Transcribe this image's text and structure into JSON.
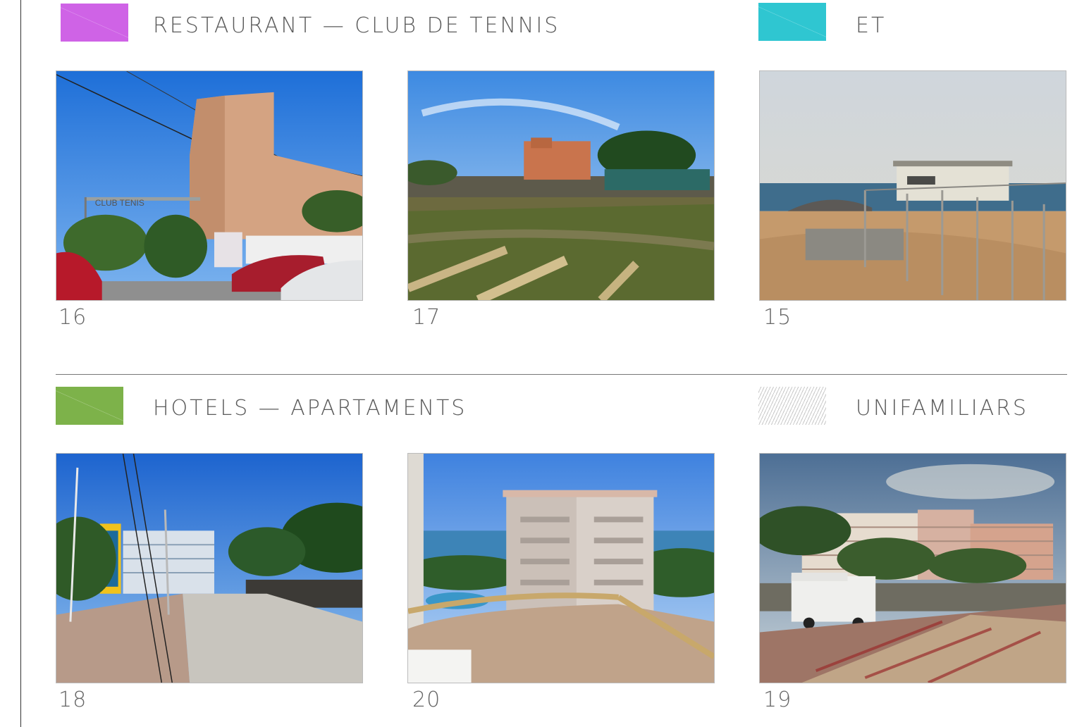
{
  "legend": {
    "restaurant": {
      "label": "RESTAURANT — CLUB DE TENNIS",
      "color": "#cf63e6"
    },
    "et": {
      "label": "ET",
      "color": "#2fc6d1"
    },
    "hotels": {
      "label": "HOTELS — APARTAMENTS",
      "color": "#7db24a"
    },
    "unifamiliars": {
      "label": "UNIFAMILIARS",
      "pattern": "diagonal-hatch"
    }
  },
  "photos": [
    {
      "number": "16",
      "subject": "club-de-tennis-entrance"
    },
    {
      "number": "17",
      "subject": "field-with-building"
    },
    {
      "number": "15",
      "subject": "beach-et-building"
    },
    {
      "number": "18",
      "subject": "street-with-hotel"
    },
    {
      "number": "20",
      "subject": "apartment-block-from-balcony"
    },
    {
      "number": "19",
      "subject": "promenade-with-apartments"
    }
  ],
  "photo_text": {
    "club_sign": "CLUB TENIS"
  }
}
